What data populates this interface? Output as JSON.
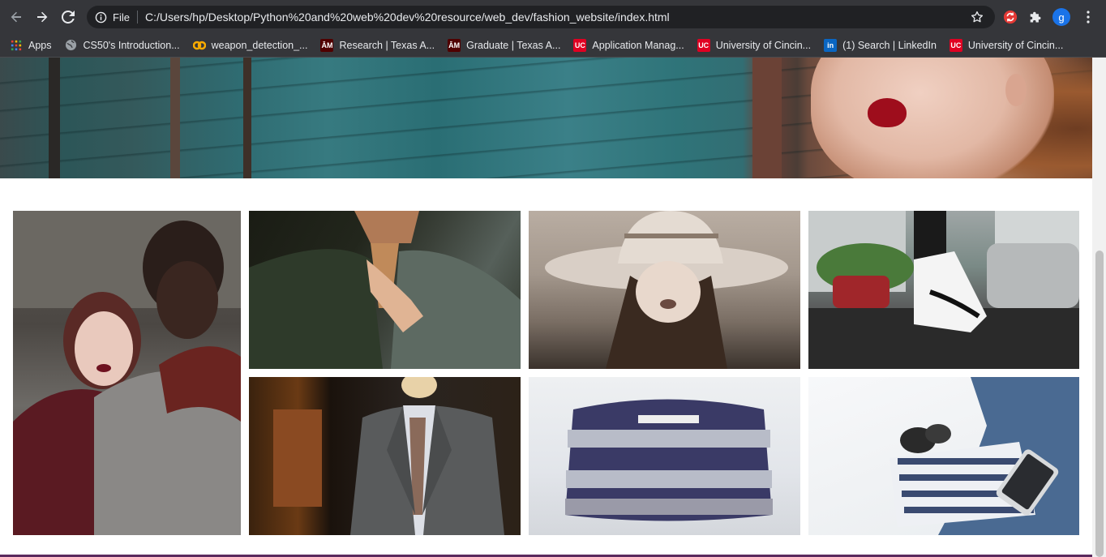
{
  "browser": {
    "omnibox": {
      "scheme_label": "File",
      "url": "C:/Users/hp/Desktop/Python%20and%20web%20dev%20resource/web_dev/fashion_website/index.html"
    },
    "profile_initial": "g",
    "bookmarks": [
      {
        "label": "Apps",
        "icon": "apps-grid-icon"
      },
      {
        "label": "CS50's Introduction...",
        "icon": "globe-icon"
      },
      {
        "label": "weapon_detection_...",
        "icon": "colab-icon"
      },
      {
        "label": "Research | Texas A...",
        "icon": "tamu-icon"
      },
      {
        "label": "Graduate | Texas A...",
        "icon": "tamu-icon"
      },
      {
        "label": "Application Manag...",
        "icon": "uc-icon"
      },
      {
        "label": "University of Cincin...",
        "icon": "uc-icon"
      },
      {
        "label": "(1) Search | LinkedIn",
        "icon": "linkedin-icon"
      },
      {
        "label": "University of Cincin...",
        "icon": "uc-icon"
      }
    ]
  },
  "page": {
    "hero_image": "hero-banner-woman-red-lips",
    "gallery": [
      {
        "subject": "two-women-portrait"
      },
      {
        "subject": "man-adjusting-tie"
      },
      {
        "subject": "woman-wide-brim-hat"
      },
      {
        "subject": "white-sneakers-street"
      },
      {
        "subject": "suit-on-mannequin"
      },
      {
        "subject": "striped-knit-sweater"
      },
      {
        "subject": "striped-shirt-sunglasses-phone"
      }
    ]
  },
  "colors": {
    "chrome_bg": "#35363a",
    "omnibox_bg": "#202124",
    "chrome_text": "#e8eaed",
    "footer_accent": "#5b2a5e",
    "profile_blue": "#1a73e8"
  }
}
